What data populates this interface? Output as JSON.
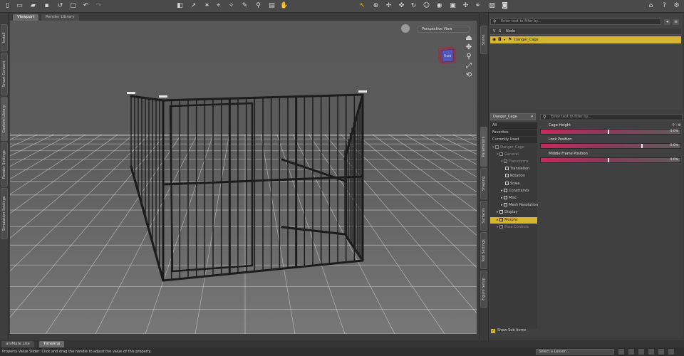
{
  "tabs": {
    "viewport": "Viewport",
    "render_library": "Render Library"
  },
  "left_tabs": [
    "Install",
    "Smart Content",
    "Content Library",
    "Render Settings",
    "Simulation Settings"
  ],
  "viewport": {
    "camera": "Perspective View",
    "cube_label": "Front"
  },
  "right_tabs": [
    "Scene",
    "Parameters",
    "Shaping",
    "Surfaces",
    "Tool Settings",
    "Figure Setup"
  ],
  "scene": {
    "search_placeholder": "Enter text to filter by...",
    "col_visible": "V",
    "col_select": "S",
    "col_node": "Node",
    "item": "Danger_Cage"
  },
  "parameters": {
    "node": "Danger_Cage",
    "search_placeholder": "Enter text to filter by...",
    "filters": [
      "All",
      "Favorites",
      "Currently Used"
    ],
    "tree": [
      {
        "label": "Danger_Cage",
        "depth": 0,
        "state": "dim"
      },
      {
        "label": "General",
        "depth": 1,
        "state": "dim"
      },
      {
        "label": "Transforms",
        "depth": 2,
        "state": "dim"
      },
      {
        "label": "Translation",
        "depth": 3,
        "state": "normal"
      },
      {
        "label": "Rotation",
        "depth": 3,
        "state": "normal"
      },
      {
        "label": "Scale",
        "depth": 3,
        "state": "normal"
      },
      {
        "label": "Constraints",
        "depth": 2,
        "state": "normal"
      },
      {
        "label": "Misc",
        "depth": 2,
        "state": "normal"
      },
      {
        "label": "Mesh Resolution",
        "depth": 2,
        "state": "normal"
      },
      {
        "label": "Display",
        "depth": 1,
        "state": "normal"
      },
      {
        "label": "Morphs",
        "depth": 1,
        "state": "selected"
      },
      {
        "label": "Pose Controls",
        "depth": 1,
        "state": "dim"
      }
    ],
    "sliders": [
      {
        "label": "Cage Height",
        "value": "0.0%",
        "level": 0.48
      },
      {
        "label": "Lock Position",
        "value": "0.0%",
        "level": 0.72
      },
      {
        "label": "Middle Frame Position",
        "value": "0.0%",
        "level": 0.48
      }
    ],
    "show_sub_items": "Show Sub Items"
  },
  "bottom": {
    "tabs": [
      "aniMate Lite",
      "Timeline"
    ],
    "status": "Property Value Slider: Click and drag the handle to adjust the value of this property.",
    "lesson": "Select a Lesson..."
  },
  "colors": {
    "accent": "#d8b52e",
    "slider": "#c8285e",
    "background": "#3c3c3c"
  }
}
